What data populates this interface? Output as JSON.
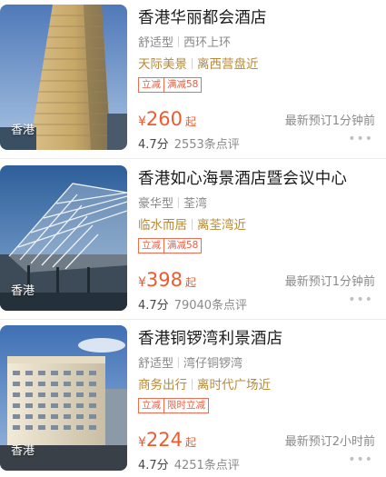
{
  "hotels": [
    {
      "name": "香港华丽都会酒店",
      "type": "舒适型",
      "location": "西环上环",
      "feature1": "天际美景",
      "feature2": "离西营盘近",
      "tags": [
        "立减",
        "满减58"
      ],
      "currency": "¥",
      "price": "260",
      "price_suffix": "起",
      "recent_booking": "最新预订1分钟前",
      "score": "4.7分",
      "reviews": "2553条点评",
      "city": "香港",
      "more_icon": "ellipsis-icon"
    },
    {
      "name": "香港如心海景酒店暨会议中心",
      "type": "豪华型",
      "location": "荃湾",
      "feature1": "临水而居",
      "feature2": "离荃湾近",
      "tags": [
        "立减",
        "满减58"
      ],
      "currency": "¥",
      "price": "398",
      "price_suffix": "起",
      "recent_booking": "最新预订1分钟前",
      "score": "4.7分",
      "reviews": "79040条点评",
      "city": "香港",
      "more_icon": "ellipsis-icon"
    },
    {
      "name": "香港铜锣湾利景酒店",
      "type": "舒适型",
      "location": "湾仔铜锣湾",
      "feature1": "商务出行",
      "feature2": "离时代广场近",
      "tags": [
        "立减",
        "限时立减"
      ],
      "currency": "¥",
      "price": "224",
      "price_suffix": "起",
      "recent_booking": "最新预订2小时前",
      "score": "4.7分",
      "reviews": "4251条点评",
      "city": "香港",
      "more_icon": "ellipsis-icon"
    }
  ],
  "colors": {
    "price": "#ef5b2f",
    "feature": "#b88a3a",
    "tag": "#ef5b3c",
    "muted": "#8a8a8a"
  }
}
